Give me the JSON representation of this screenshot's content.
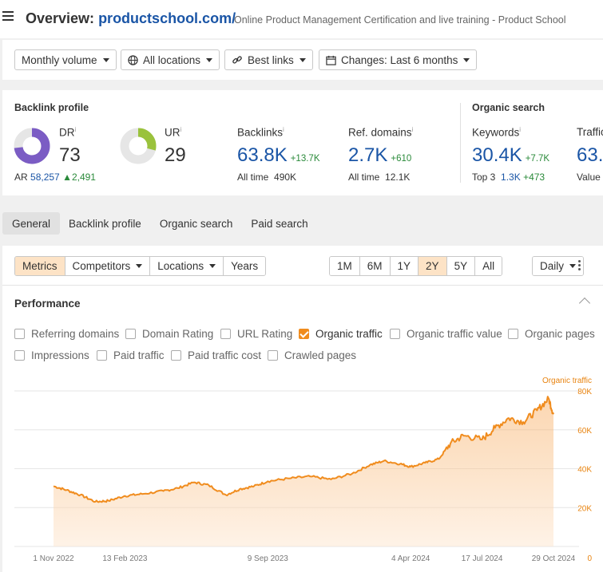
{
  "header": {
    "title_prefix": "Overview:",
    "title_domain": "productschool.com/",
    "subtitle": "Online Product Management Certification and live training - Product School"
  },
  "filters": {
    "volume": "Monthly volume",
    "locations": "All locations",
    "links": "Best links",
    "changes": "Changes: Last 6 months"
  },
  "backlink_profile": {
    "title": "Backlink profile",
    "dr_label": "DR",
    "dr_value": "73",
    "dr_fraction": 0.73,
    "ar_label": "AR",
    "ar_value": "58,257",
    "ar_delta": "2,491",
    "ur_label": "UR",
    "ur_value": "29",
    "ur_fraction": 0.29,
    "backlinks_label": "Backlinks",
    "backlinks_value": "63.8K",
    "backlinks_delta": "+13.7K",
    "backlinks_alltime_label": "All time",
    "backlinks_alltime": "490K",
    "refdomains_label": "Ref. domains",
    "refdomains_value": "2.7K",
    "refdomains_delta": "+610",
    "refdomains_alltime_label": "All time",
    "refdomains_alltime": "12.1K"
  },
  "organic_search": {
    "title": "Organic search",
    "keywords_label": "Keywords",
    "keywords_value": "30.4K",
    "keywords_delta": "+7.7K",
    "top3_label": "Top 3",
    "top3_value": "1.3K",
    "top3_delta": "+473",
    "traffic_label": "Traffic",
    "traffic_value": "63.",
    "value_label": "Value"
  },
  "tabs": [
    "General",
    "Backlink profile",
    "Organic search",
    "Paid search"
  ],
  "controls": {
    "metrics": "Metrics",
    "competitors": "Competitors",
    "locations": "Locations",
    "years": "Years",
    "ranges": [
      "1M",
      "6M",
      "1Y",
      "2Y",
      "5Y",
      "All"
    ],
    "selected_range": "2Y",
    "interval": "Daily"
  },
  "performance": {
    "title": "Performance",
    "checkboxes": [
      {
        "label": "Referring domains",
        "checked": false
      },
      {
        "label": "Domain Rating",
        "checked": false
      },
      {
        "label": "URL Rating",
        "checked": false
      },
      {
        "label": "Organic traffic",
        "checked": true
      },
      {
        "label": "Organic traffic value",
        "checked": false
      },
      {
        "label": "Organic pages",
        "checked": false
      },
      {
        "label": "Impressions",
        "checked": false
      },
      {
        "label": "Paid traffic",
        "checked": false
      },
      {
        "label": "Paid traffic cost",
        "checked": false
      },
      {
        "label": "Crawled pages",
        "checked": false
      }
    ]
  },
  "colors": {
    "accent": "#f08c1e",
    "link_blue": "#1a55a6",
    "dr_purple": "#7b5cc4",
    "ur_green": "#9ac23c",
    "positive": "#2a8a3a"
  },
  "chart_data": {
    "type": "area",
    "series": [
      {
        "name": "Organic traffic",
        "points": [
          [
            "2022-11-01",
            31000
          ],
          [
            "2022-11-20",
            29000
          ],
          [
            "2022-12-10",
            26500
          ],
          [
            "2023-01-01",
            23000
          ],
          [
            "2023-01-20",
            23500
          ],
          [
            "2023-02-13",
            26000
          ],
          [
            "2023-03-10",
            27000
          ],
          [
            "2023-04-10",
            28500
          ],
          [
            "2023-05-01",
            30000
          ],
          [
            "2023-05-25",
            33000
          ],
          [
            "2023-06-15",
            31500
          ],
          [
            "2023-07-10",
            26500
          ],
          [
            "2023-07-30",
            29500
          ],
          [
            "2023-08-20",
            31000
          ],
          [
            "2023-09-09",
            33500
          ],
          [
            "2023-10-10",
            35000
          ],
          [
            "2023-11-10",
            36000
          ],
          [
            "2023-12-10",
            34500
          ],
          [
            "2024-01-10",
            37500
          ],
          [
            "2024-02-05",
            42000
          ],
          [
            "2024-02-25",
            44000
          ],
          [
            "2024-03-20",
            42500
          ],
          [
            "2024-04-04",
            41000
          ],
          [
            "2024-04-25",
            43000
          ],
          [
            "2024-05-15",
            45000
          ],
          [
            "2024-06-01",
            53000
          ],
          [
            "2024-06-20",
            57000
          ],
          [
            "2024-07-17",
            55000
          ],
          [
            "2024-08-05",
            61000
          ],
          [
            "2024-08-25",
            66000
          ],
          [
            "2024-09-15",
            64000
          ],
          [
            "2024-10-05",
            70000
          ],
          [
            "2024-10-22",
            76000
          ],
          [
            "2024-10-29",
            68000
          ]
        ]
      }
    ],
    "x_ticks": [
      "1 Nov 2022",
      "13 Feb 2023",
      "9 Sep 2023",
      "4 Apr 2024",
      "17 Jul 2024",
      "29 Oct 2024"
    ],
    "y_ticks": [
      "0",
      "20K",
      "40K",
      "60K",
      "80K"
    ],
    "ylim": [
      0,
      80000
    ],
    "grid": true,
    "legend": "top-right"
  }
}
